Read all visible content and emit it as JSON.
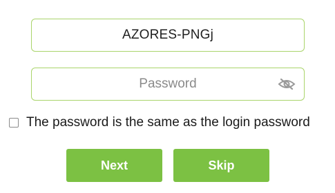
{
  "form": {
    "ssid_value": "AZORES-PNGj",
    "password_placeholder": "Password",
    "password_value": "",
    "password_visibility_icon": "eye-hidden-icon",
    "same_password_label": "The password is the same as the login password",
    "same_password_checked": false
  },
  "actions": {
    "next_label": "Next",
    "skip_label": "Skip"
  },
  "colors": {
    "accent": "#7cc143",
    "field_border": "#a9d46a"
  }
}
